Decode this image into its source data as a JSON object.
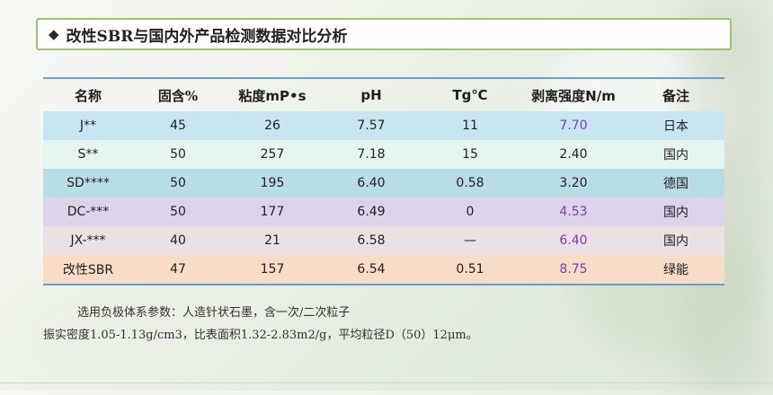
{
  "title": {
    "bullet": "◆",
    "text": "改性SBR与国内外产品检测数据对比分析"
  },
  "table": {
    "headers": [
      "名称",
      "固含%",
      "粘度mP•s",
      "pH",
      "Tg℃",
      "剥离强度N/m",
      "备注"
    ],
    "rows": [
      [
        "J**",
        "45",
        "26",
        "7.57",
        "11",
        "7.70",
        "日本"
      ],
      [
        "S**",
        "50",
        "257",
        "7.18",
        "15",
        "2.40",
        "国内"
      ],
      [
        "SD****",
        "50",
        "195",
        "6.40",
        "0.58",
        "3.20",
        "德国"
      ],
      [
        "DC-***",
        "50",
        "177",
        "6.49",
        "0",
        "4.53",
        "国内"
      ],
      [
        "JX-***",
        "40",
        "21",
        "6.58",
        "—",
        "6.40",
        "国内"
      ],
      [
        "改性SBR",
        "47",
        "157",
        "6.54",
        "0.51",
        "8.75",
        "绿能"
      ]
    ]
  },
  "notes": {
    "line1": "选用负极体系参数：人造针状石墨，含一次/二次粒子",
    "line2": "振实密度1.05-1.13g/cm3，比表面积1.32-2.83m2/g，平均粒径D（50）12μm。"
  },
  "colors": {
    "highlight": "#7b3fb3",
    "title_border": "#9cc46a",
    "table_rule": "#6a9ccf"
  }
}
